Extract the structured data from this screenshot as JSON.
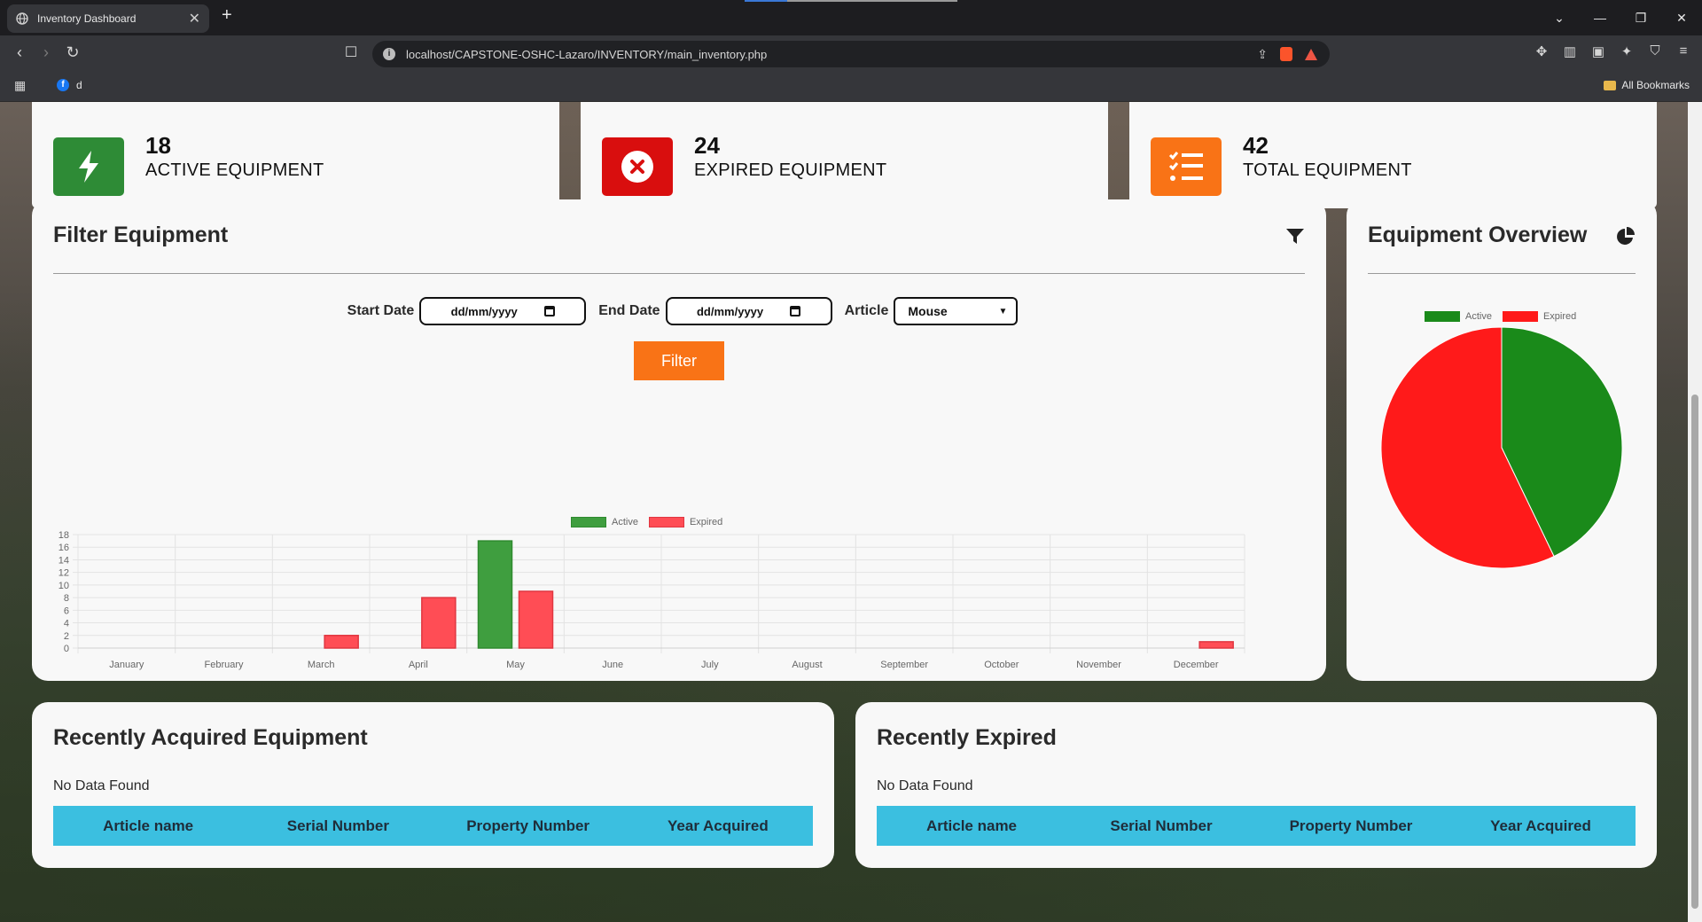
{
  "browser": {
    "tab_title": "Inventory Dashboard",
    "url": "localhost/CAPSTONE-OSHC-Lazaro/INVENTORY/main_inventory.php",
    "bookmark_item": "d",
    "all_bookmarks": "All Bookmarks"
  },
  "stats": [
    {
      "number": "18",
      "label": "ACTIVE EQUIPMENT",
      "color": "#2e8b36"
    },
    {
      "number": "24",
      "label": "EXPIRED EQUIPMENT",
      "color": "#d90e0e"
    },
    {
      "number": "42",
      "label": "TOTAL EQUIPMENT",
      "color": "#f97316"
    }
  ],
  "filter": {
    "title": "Filter Equipment",
    "start_label": "Start Date",
    "start_value": "dd/mm/yyyy",
    "end_label": "End Date",
    "end_value": "dd/mm/yyyy",
    "article_label": "Article",
    "article_value": "Mouse",
    "button": "Filter"
  },
  "overview": {
    "title": "Equipment Overview"
  },
  "recent_acquired": {
    "title": "Recently Acquired Equipment",
    "empty": "No Data Found",
    "columns": [
      "Article name",
      "Serial Number",
      "Property Number",
      "Year Acquired"
    ]
  },
  "recent_expired": {
    "title": "Recently Expired",
    "empty": "No Data Found",
    "columns": [
      "Article name",
      "Serial Number",
      "Property Number",
      "Year Acquired"
    ]
  },
  "chart_data": [
    {
      "type": "bar",
      "categories": [
        "January",
        "February",
        "March",
        "April",
        "May",
        "June",
        "July",
        "August",
        "September",
        "October",
        "November",
        "December"
      ],
      "series": [
        {
          "name": "Active",
          "values": [
            0,
            0,
            0,
            0,
            17,
            0,
            0,
            0,
            0,
            0,
            0,
            0
          ],
          "color": "#3f9e3f"
        },
        {
          "name": "Expired",
          "values": [
            0,
            0,
            2,
            8,
            9,
            0,
            0,
            0,
            0,
            0,
            0,
            1
          ],
          "color": "#ff4d55"
        }
      ],
      "ylim": [
        0,
        18
      ],
      "yticks": [
        "0",
        "2",
        "4",
        "6",
        "8",
        "10",
        "12",
        "14",
        "16",
        "18"
      ],
      "legend": "top",
      "grid": true
    },
    {
      "type": "pie",
      "categories": [
        "Active",
        "Expired"
      ],
      "values": [
        18,
        24
      ],
      "colors": [
        "#1a8a1a",
        "#ff1a1a"
      ],
      "legend": "top"
    }
  ]
}
